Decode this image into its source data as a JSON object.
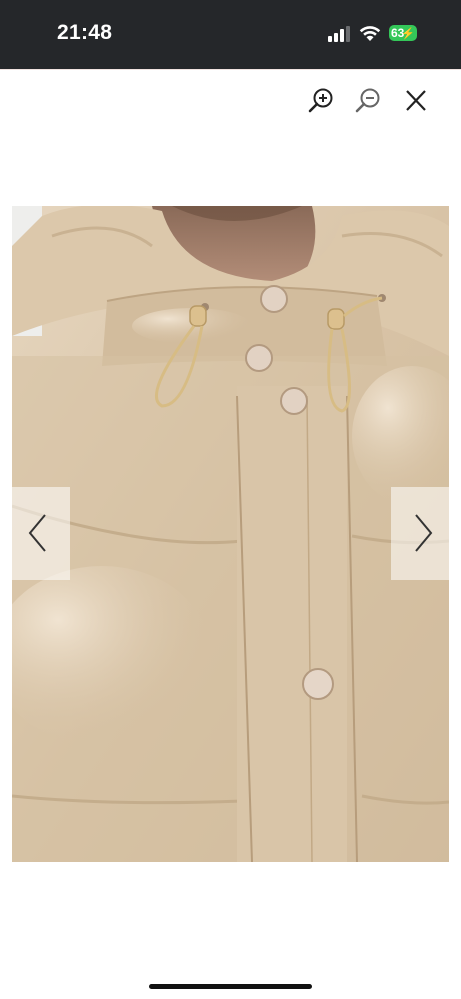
{
  "status_bar": {
    "time": "21:48",
    "battery_level": "63",
    "icons": [
      "signal-icon",
      "wifi-icon",
      "battery-icon"
    ]
  },
  "toolbar": {
    "icons": [
      "zoom-in-icon",
      "zoom-out-icon",
      "close-icon"
    ]
  },
  "viewer": {
    "image_subject": "beige-puffer-jacket-hood-closeup",
    "prev_icon": "chevron-left-icon",
    "next_icon": "chevron-right-icon"
  },
  "colors": {
    "status_bar_bg": "#25272a",
    "battery_green": "#34c759",
    "jacket_beige": "#d9c6ad"
  }
}
